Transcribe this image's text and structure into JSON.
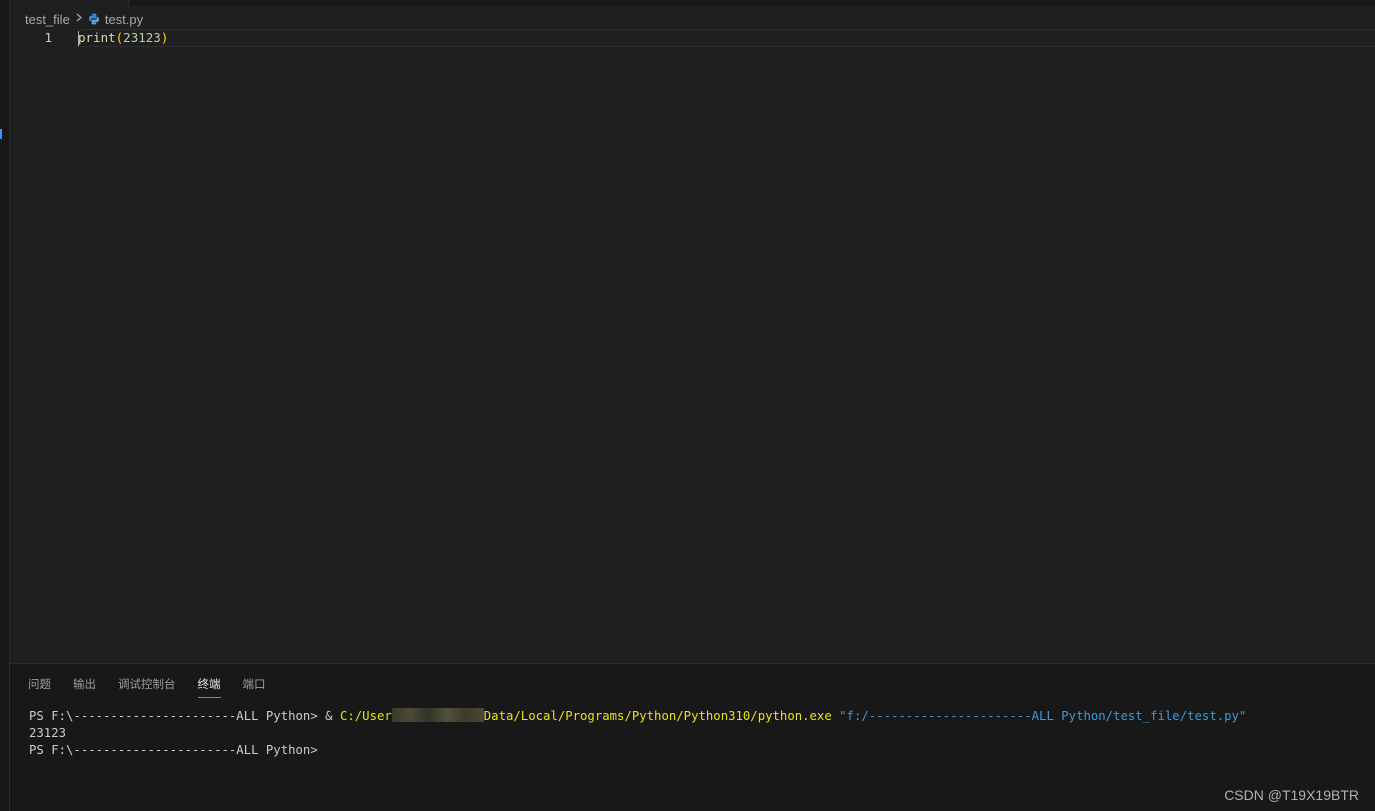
{
  "breadcrumb": {
    "folder": "test_file",
    "file": "test.py"
  },
  "editor": {
    "line_number": "1",
    "code": {
      "fn": "print",
      "open": "(",
      "number": "23123",
      "close": ")"
    }
  },
  "panel": {
    "tabs": [
      {
        "label": "问题"
      },
      {
        "label": "输出"
      },
      {
        "label": "调试控制台"
      },
      {
        "label": "终端",
        "active": true
      },
      {
        "label": "端口"
      }
    ]
  },
  "terminal": {
    "line1_prompt": "PS F:\\----------------------ALL Python> ",
    "line1_amp": "& ",
    "line1_cmd_start": "C:/User",
    "line1_cmd_end": "Data/Local/Programs/Python/Python310/python.exe",
    "line1_arg": "\"f:/----------------------ALL Python/test_file/test.py\"",
    "line2_output": "23123",
    "line3_prompt": "PS F:\\----------------------ALL Python>"
  },
  "watermark": "CSDN @T19X19BTR",
  "colors": {
    "background": "#1f1f1f",
    "accent": "#3794ff",
    "terminal_yellow": "#e5e510",
    "terminal_blue": "#3b9ad8"
  },
  "icons": {
    "file_icon": "python-icon",
    "separator": "chevron-right-icon"
  }
}
